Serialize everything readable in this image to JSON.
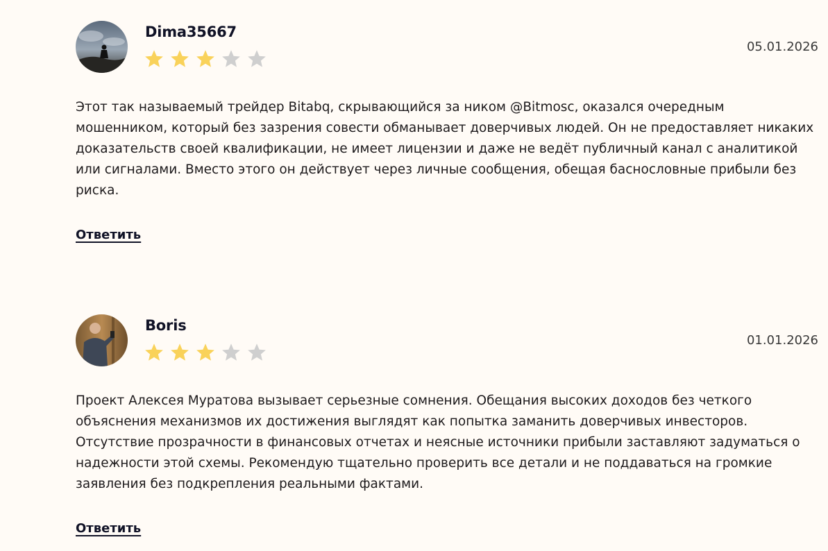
{
  "reviews": [
    {
      "author": "Dima35667",
      "rating": 3,
      "max_rating": 5,
      "date": "05.01.2026",
      "text": "Этот так называемый трейдер Bitabq, скрывающийся за ником @Bitmosc, оказался очередным мошенником, который без зазрения совести обманывает доверчивых людей. Он не предоставляет никаких доказательств своей квалификации, не имеет лицензии и даже не ведёт публичный канал с аналитикой или сигналами. Вместо этого он действует через личные сообщения, обещая баснословные прибыли без риска.",
      "reply_label": "Ответить"
    },
    {
      "author": "Boris",
      "rating": 3,
      "max_rating": 5,
      "date": "01.01.2026",
      "text": "Проект Алексея Муратова вызывает серьезные сомнения. Обещания высоких доходов без четкого объяснения механизмов их достижения выглядят как попытка заманить доверчивых инвесторов. Отсутствие прозрачности в финансовых отчетах и неясные источники прибыли заставляют задуматься о надежности этой схемы. Рекомендую тщательно проверить все детали и не поддаваться на громкие заявления без подкрепления реальными фактами.",
      "reply_label": "Ответить"
    }
  ],
  "colors": {
    "background": "#fffbf6",
    "star_filled": "#f9d25a",
    "star_empty": "#cfcfcf",
    "author": "#101226",
    "text": "#1d1a1c"
  }
}
